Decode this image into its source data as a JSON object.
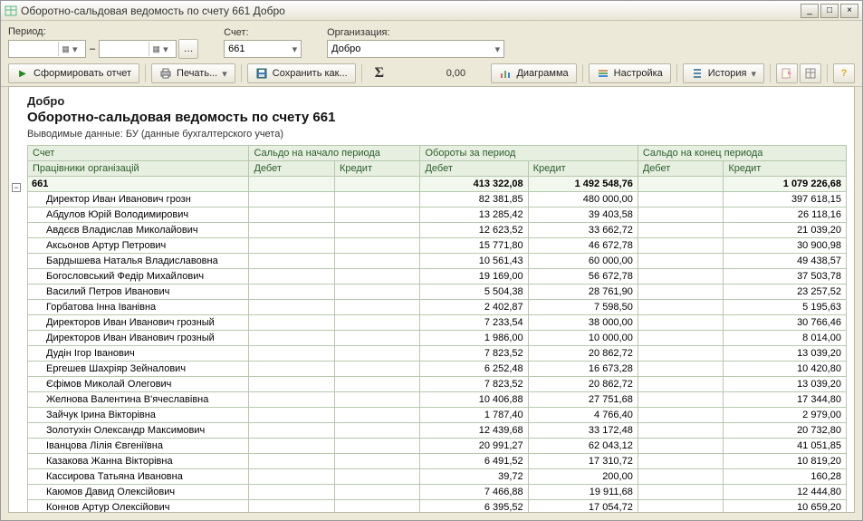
{
  "window": {
    "title": "Оборотно-сальдовая ведомость по счету 661 Добро"
  },
  "params": {
    "period_label": "Период:",
    "account_label": "Счет:",
    "account_value": "661",
    "org_label": "Организация:",
    "org_value": "Добро"
  },
  "toolbar": {
    "form_report": "Сформировать отчет",
    "print": "Печать...",
    "save_as": "Сохранить как...",
    "sum_value": "0,00",
    "diagram": "Диаграмма",
    "settings": "Настройка",
    "history": "История"
  },
  "report": {
    "org": "Добро",
    "title": "Оборотно-сальдовая ведомость по счету 661",
    "subtitle": "Выводимые данные:  БУ (данные бухгалтерского учета)",
    "headers": {
      "acct": "Счет",
      "sub": "Працівники організацій",
      "open": "Сальдо на начало периода",
      "turn": "Обороты за период",
      "close": "Сальдо на конец периода",
      "debit": "Дебет",
      "credit": "Кредит"
    },
    "total": {
      "acct": "661",
      "open_d": "",
      "open_c": "",
      "turn_d": "413 322,08",
      "turn_c": "1 492 548,76",
      "close_d": "",
      "close_c": "1 079 226,68"
    },
    "rows": [
      {
        "name": "Директор Иван Иванович грозн",
        "td": "82 381,85",
        "tc": "480 000,00",
        "cc": "397 618,15"
      },
      {
        "name": "Абдулов Юрій Володимирович",
        "td": "13 285,42",
        "tc": "39 403,58",
        "cc": "26 118,16"
      },
      {
        "name": "Авдєєв Владислав Миколайович",
        "td": "12 623,52",
        "tc": "33 662,72",
        "cc": "21 039,20"
      },
      {
        "name": "Аксьонов Артур Петрович",
        "td": "15 771,80",
        "tc": "46 672,78",
        "cc": "30 900,98"
      },
      {
        "name": "Бардышева Наталья Владиславовна",
        "td": "10 561,43",
        "tc": "60 000,00",
        "cc": "49 438,57"
      },
      {
        "name": "Богословський Федір Михайлович",
        "td": "19 169,00",
        "tc": "56 672,78",
        "cc": "37 503,78"
      },
      {
        "name": "Василий Петров Иванович",
        "td": "5 504,38",
        "tc": "28 761,90",
        "cc": "23 257,52"
      },
      {
        "name": "Горбатова Інна Іванівна",
        "td": "2 402,87",
        "tc": "7 598,50",
        "cc": "5 195,63"
      },
      {
        "name": "Директоров Иван Иванович грозный",
        "td": "7 233,54",
        "tc": "38 000,00",
        "cc": "30 766,46"
      },
      {
        "name": "Директоров Иван Иванович грозный",
        "td": "1 986,00",
        "tc": "10 000,00",
        "cc": "8 014,00"
      },
      {
        "name": "Дудін Ігор Іванович",
        "td": "7 823,52",
        "tc": "20 862,72",
        "cc": "13 039,20"
      },
      {
        "name": "Ергешев Шахріяр Зейналович",
        "td": "6 252,48",
        "tc": "16 673,28",
        "cc": "10 420,80"
      },
      {
        "name": "Єфімов Миколай Олегович",
        "td": "7 823,52",
        "tc": "20 862,72",
        "cc": "13 039,20"
      },
      {
        "name": "Желнова Валентина В'ячеславівна",
        "td": "10 406,88",
        "tc": "27 751,68",
        "cc": "17 344,80"
      },
      {
        "name": "Зайчук Ірина Вікторівна",
        "td": "1 787,40",
        "tc": "4 766,40",
        "cc": "2 979,00"
      },
      {
        "name": "Золотухін Олександр Максимович",
        "td": "12 439,68",
        "tc": "33 172,48",
        "cc": "20 732,80"
      },
      {
        "name": "Іванцова Лілія Євгеніївна",
        "td": "20 991,27",
        "tc": "62 043,12",
        "cc": "41 051,85"
      },
      {
        "name": "Казакова Жанна Вікторівна",
        "td": "6 491,52",
        "tc": "17 310,72",
        "cc": "10 819,20"
      },
      {
        "name": "Кассирова Татьяна Ивановна",
        "td": "39,72",
        "tc": "200,00",
        "cc": "160,28"
      },
      {
        "name": "Каюмов Давид Олексійович",
        "td": "7 466,88",
        "tc": "19 911,68",
        "cc": "12 444,80"
      },
      {
        "name": "Коннов Артур Олексійович",
        "td": "6 395,52",
        "tc": "17 054,72",
        "cc": "10 659,20"
      }
    ]
  }
}
